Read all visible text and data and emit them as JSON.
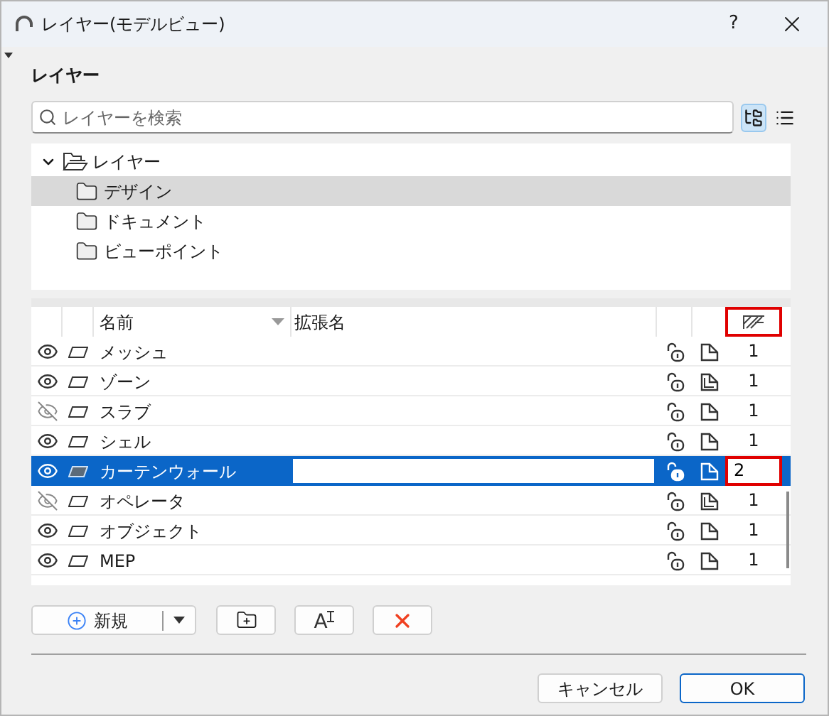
{
  "window": {
    "title": "レイヤー(モデルビュー)",
    "help": "?"
  },
  "section_title": "レイヤー",
  "search": {
    "placeholder": "レイヤーを検索"
  },
  "view_modes": [
    {
      "kind": "tree",
      "selected": true
    },
    {
      "kind": "list",
      "selected": false
    }
  ],
  "tree": {
    "label": "レイヤー",
    "expanded": true,
    "children": [
      {
        "label": "デザイン",
        "selected": true
      },
      {
        "label": "ドキュメント",
        "selected": false
      },
      {
        "label": "ビューポイント",
        "selected": false
      }
    ]
  },
  "table": {
    "columns": [
      "名前",
      "拡張名"
    ],
    "header_highlighted": true,
    "rows": [
      {
        "name": "メッシュ",
        "visible": true,
        "stacked": false,
        "value": "1",
        "selected": false,
        "highlighted": false
      },
      {
        "name": "ゾーン",
        "visible": true,
        "stacked": true,
        "value": "1",
        "selected": false,
        "highlighted": false
      },
      {
        "name": "スラブ",
        "visible": false,
        "stacked": false,
        "value": "1",
        "selected": false,
        "highlighted": false
      },
      {
        "name": "シェル",
        "visible": true,
        "stacked": false,
        "value": "1",
        "selected": false,
        "highlighted": false
      },
      {
        "name": "カーテンウォール",
        "visible": true,
        "stacked": false,
        "value": "2",
        "selected": true,
        "highlighted": true
      },
      {
        "name": "オペレータ",
        "visible": false,
        "stacked": true,
        "value": "1",
        "selected": false,
        "highlighted": false
      },
      {
        "name": "オブジェクト",
        "visible": true,
        "stacked": false,
        "value": "1",
        "selected": false,
        "highlighted": false
      },
      {
        "name": "MEP",
        "visible": true,
        "stacked": false,
        "value": "1",
        "selected": false,
        "highlighted": false
      }
    ]
  },
  "toolbar": {
    "new_label": "新規",
    "rename_glyph": "A"
  },
  "buttons": [
    {
      "label": "キャンセル",
      "default": false
    },
    {
      "label": "OK",
      "default": true
    }
  ]
}
